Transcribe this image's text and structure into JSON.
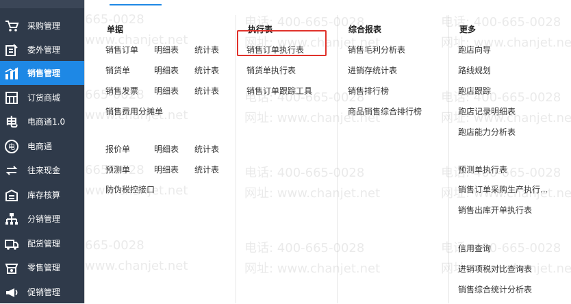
{
  "sidebar": {
    "items": [
      {
        "label": "采购管理",
        "icon": "purchase-cart-icon"
      },
      {
        "label": "委外管理",
        "icon": "outsourcing-icon"
      },
      {
        "label": "销售管理",
        "icon": "sales-chart-icon",
        "active": true
      },
      {
        "label": "订货商城",
        "icon": "store-icon"
      },
      {
        "label": "电商通1.0",
        "icon": "ecommerce-e-icon"
      },
      {
        "label": "电商通",
        "icon": "ecommerce-circle-icon"
      },
      {
        "label": "往来现金",
        "icon": "cash-exchange-icon"
      },
      {
        "label": "库存核算",
        "icon": "inventory-icon"
      },
      {
        "label": "分销管理",
        "icon": "distribution-icon"
      },
      {
        "label": "配货管理",
        "icon": "allocation-icon"
      },
      {
        "label": "零售管理",
        "icon": "retail-icon"
      },
      {
        "label": "促销管理",
        "icon": "promotion-icon"
      }
    ]
  },
  "panel": {
    "columns": {
      "documents": {
        "title": "单据",
        "rows": [
          [
            "销售订单",
            "明细表",
            "统计表"
          ],
          [
            "销货单",
            "明细表",
            "统计表"
          ],
          [
            "销售发票",
            "明细表",
            "统计表"
          ],
          [
            "销售费用分摊单"
          ],
          [
            "报价单",
            "明细表",
            "统计表"
          ],
          [
            "预测单",
            "明细表",
            "统计表"
          ],
          [
            "防伪税控接口"
          ]
        ]
      },
      "execution": {
        "title": "执行表",
        "items": [
          "销售订单执行表",
          "销货单执行表",
          "销售订单跟踪工具"
        ]
      },
      "reports": {
        "title": "综合报表",
        "items": [
          "销售毛利分析表",
          "进销存统计表",
          "销售排行榜",
          "商品销售综合排行榜"
        ]
      },
      "more": {
        "title": "更多",
        "items": [
          "跑店向导",
          "路线规划",
          "跑店跟踪",
          "跑店记录明细表",
          "跑店能力分析表",
          "预测单执行表",
          "销售订单采购生产执行...",
          "销售出库开单执行表",
          "信用查询",
          "进销项税对比查询表",
          "销售综合统计分析表"
        ]
      }
    }
  },
  "watermark": {
    "phone": "665-0028",
    "phone_full": "电话: 400-665-0028",
    "site": "www.chanjet.net",
    "site_full": "网址: www.chanjet.net"
  },
  "colors": {
    "sidebar_bg": "#2f3a4a",
    "active_bg": "#1e88e5",
    "highlight_border": "#e0312a"
  }
}
